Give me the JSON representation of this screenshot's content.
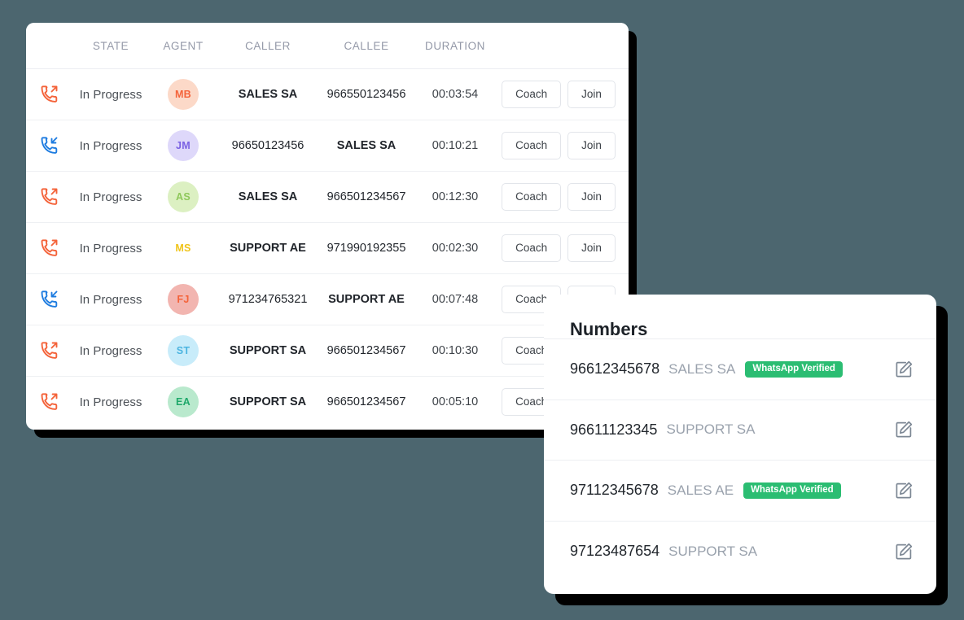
{
  "colors": {
    "background": "#4c666f",
    "card": "#ffffff",
    "shadow": "#000000",
    "outbound": "#f4633a",
    "inbound": "#1e7ce0",
    "badge_green": "#2bbd72",
    "header_text": "#9499a8",
    "muted_text": "#9aa2ad"
  },
  "calls_card": {
    "columns": [
      {
        "key": "direction",
        "label": ""
      },
      {
        "key": "state",
        "label": "STATE"
      },
      {
        "key": "agent",
        "label": "AGENT"
      },
      {
        "key": "caller",
        "label": "CALLER"
      },
      {
        "key": "callee",
        "label": "CALLEE"
      },
      {
        "key": "duration",
        "label": "DURATION"
      },
      {
        "key": "actions",
        "label": ""
      }
    ],
    "action_labels": {
      "coach": "Coach",
      "join": "Join"
    },
    "rows": [
      {
        "direction": "outbound-call-icon",
        "state": "In Progress",
        "agent_initials": "MB",
        "agent_bg": "#fcd9c8",
        "agent_fg": "#f4633a",
        "caller": "SALES SA",
        "caller_is_name": true,
        "callee": "966550123456",
        "callee_is_name": false,
        "duration": "00:03:54"
      },
      {
        "direction": "inbound-call-icon",
        "state": "In Progress",
        "agent_initials": "JM",
        "agent_bg": "#ded8fa",
        "agent_fg": "#7b62e3",
        "caller": "96650123456",
        "caller_is_name": false,
        "callee": "SALES SA",
        "callee_is_name": true,
        "duration": "00:10:21"
      },
      {
        "direction": "outbound-call-icon",
        "state": "In Progress",
        "agent_initials": "AS",
        "agent_bg": "#dcf0c2",
        "agent_fg": "#8ec85a",
        "caller": "SALES SA",
        "caller_is_name": true,
        "callee": "966501234567",
        "callee_is_name": false,
        "duration": "00:12:30"
      },
      {
        "direction": "outbound-call-icon",
        "state": "In Progress",
        "agent_initials": "MS",
        "agent_bg": "#fced b0",
        "agent_fg": "#f0c41b",
        "caller": "SUPPORT AE",
        "caller_is_name": true,
        "callee": "971990192355",
        "callee_is_name": false,
        "duration": "00:02:30"
      },
      {
        "direction": "inbound-call-icon",
        "state": "In Progress",
        "agent_initials": "FJ",
        "agent_bg": "#f2b5b0",
        "agent_fg": "#f4633a",
        "caller": "971234765321",
        "caller_is_name": false,
        "callee": "SUPPORT AE",
        "callee_is_name": true,
        "duration": "00:07:48"
      },
      {
        "direction": "outbound-call-icon",
        "state": "In Progress",
        "agent_initials": "ST",
        "agent_bg": "#c8ecfa",
        "agent_fg": "#4bb4e0",
        "caller": "SUPPORT SA",
        "caller_is_name": true,
        "callee": "966501234567",
        "callee_is_name": false,
        "duration": "00:10:30"
      },
      {
        "direction": "outbound-call-icon",
        "state": "In Progress",
        "agent_initials": "EA",
        "agent_bg": "#b9e9cd",
        "agent_fg": "#1fa86a",
        "caller": "SUPPORT SA",
        "caller_is_name": true,
        "callee": "966501234567",
        "callee_is_name": false,
        "duration": "00:05:10"
      }
    ]
  },
  "numbers_card": {
    "title": "Numbers",
    "edit_icon": "edit-pencil-icon",
    "rows": [
      {
        "number": "96612345678",
        "label": "SALES SA",
        "badge": "WhatsApp Verified"
      },
      {
        "number": "96611123345",
        "label": "SUPPORT SA",
        "badge": null
      },
      {
        "number": "97112345678",
        "label": "SALES AE",
        "badge": "WhatsApp Verified"
      },
      {
        "number": "97123487654",
        "label": "SUPPORT SA",
        "badge": null
      }
    ]
  }
}
